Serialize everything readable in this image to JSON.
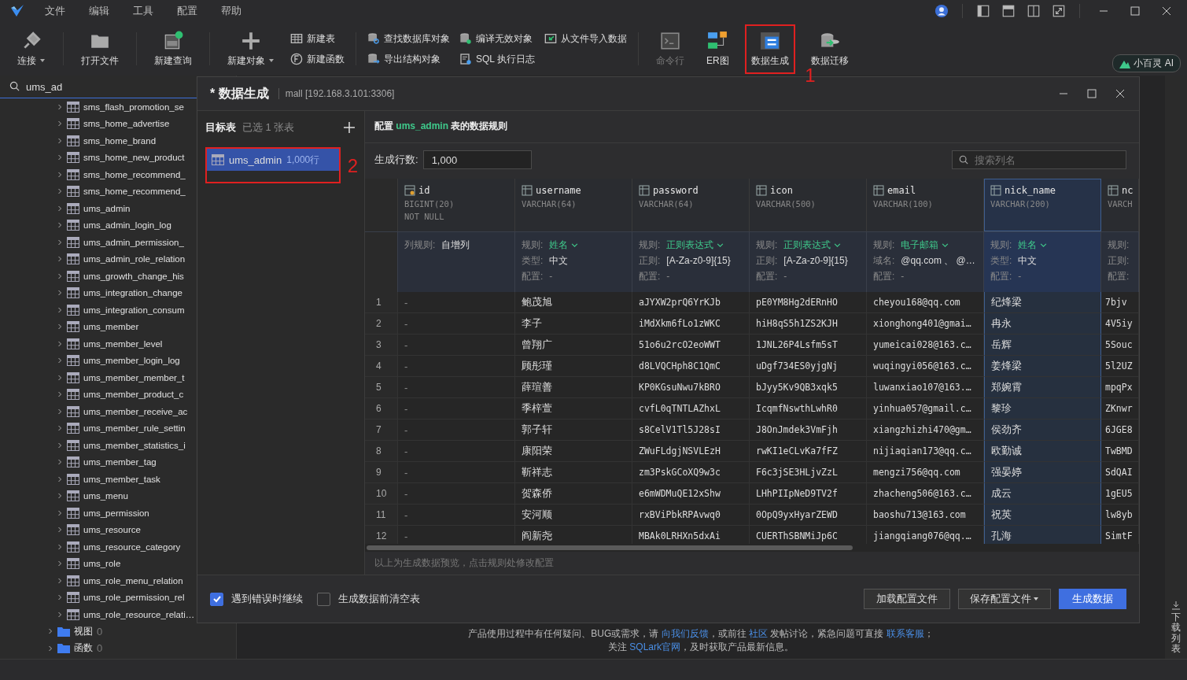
{
  "menu": [
    "文件",
    "编辑",
    "工具",
    "配置",
    "帮助"
  ],
  "toolbar": [
    {
      "items": [
        {
          "label": "连接",
          "kind": "big",
          "dropdown": true,
          "disabled": false
        }
      ]
    },
    {
      "items": [
        {
          "label": "打开文件",
          "kind": "big",
          "dropdown": false,
          "disabled": false
        }
      ]
    },
    {
      "items": [
        {
          "label": "新建查询",
          "kind": "big",
          "dropdown": false,
          "disabled": false
        }
      ]
    },
    {
      "items": [
        {
          "label": "新建对象",
          "kind": "big",
          "dropdown": true,
          "disabled": false
        },
        {
          "label": "新建表",
          "kind": "small",
          "dropdown": false,
          "disabled": false
        },
        {
          "label": "新建函数",
          "kind": "small",
          "dropdown": false,
          "disabled": false
        }
      ]
    },
    {
      "items": [
        {
          "label": "查找数据库对象",
          "kind": "small",
          "dropdown": false,
          "disabled": false
        },
        {
          "label": "导出结构对象",
          "kind": "small",
          "dropdown": false,
          "disabled": false
        },
        {
          "label": "编译无效对象",
          "kind": "small",
          "dropdown": false,
          "disabled": false
        },
        {
          "label": "SQL 执行日志",
          "kind": "small",
          "dropdown": false,
          "disabled": false
        },
        {
          "label": "从文件导入数据",
          "kind": "small",
          "dropdown": false,
          "disabled": false
        }
      ]
    },
    {
      "items": [
        {
          "label": "命令行",
          "kind": "big",
          "dropdown": false,
          "disabled": true
        },
        {
          "label": "ER图",
          "kind": "big",
          "dropdown": false,
          "disabled": false
        },
        {
          "label": "数据生成",
          "kind": "big",
          "dropdown": false,
          "disabled": false,
          "annotation": "1"
        },
        {
          "label": "数据迁移",
          "kind": "big",
          "dropdown": false,
          "disabled": false
        }
      ]
    }
  ],
  "ai_button": "小百灵 AI",
  "sidebar": {
    "search": "ums_ad",
    "tables": [
      "sms_flash_promotion_se",
      "sms_home_advertise",
      "sms_home_brand",
      "sms_home_new_product",
      "sms_home_recommend_",
      "sms_home_recommend_",
      "ums_admin",
      "ums_admin_login_log",
      "ums_admin_permission_",
      "ums_admin_role_relation",
      "ums_growth_change_his",
      "ums_integration_change",
      "ums_integration_consum",
      "ums_member",
      "ums_member_level",
      "ums_member_login_log",
      "ums_member_member_t",
      "ums_member_product_c",
      "ums_member_receive_ac",
      "ums_member_rule_settin",
      "ums_member_statistics_i",
      "ums_member_tag",
      "ums_member_task",
      "ums_menu",
      "ums_permission",
      "ums_resource",
      "ums_resource_category",
      "ums_role",
      "ums_role_menu_relation",
      "ums_role_permission_rel",
      "ums_role_resource_relati…"
    ],
    "folders": [
      {
        "label": "视图",
        "count": "0"
      },
      {
        "label": "函数",
        "count": "0"
      }
    ]
  },
  "help": [
    [
      {
        "text": "产品使用过程中有任何疑问、BUG或需求，请 ",
        "link": false
      },
      {
        "text": "向我们反馈",
        "link": true
      },
      {
        "text": "，或前往 ",
        "link": false
      },
      {
        "text": "社区",
        "link": true
      },
      {
        "text": " 发帖讨论，紧急问题可直接 ",
        "link": false
      },
      {
        "text": "联系客服",
        "link": true
      },
      {
        "text": "；",
        "link": false
      }
    ],
    [
      {
        "text": "关注 ",
        "link": false
      },
      {
        "text": "SQLark官网",
        "link": true
      },
      {
        "text": "，及时获取产品最新信息。",
        "link": false
      }
    ]
  ],
  "download_list": "下载列表",
  "dialog": {
    "title": "* 数据生成",
    "connection": "mall [192.168.3.101:3306]",
    "targets_title": "目标表",
    "targets_count": "已选 1 张表",
    "targets": [
      {
        "name": "ums_admin",
        "rows": "1,000行",
        "selected": true,
        "annotation": "2"
      }
    ],
    "config_prefix": "配置",
    "config_table": "ums_admin",
    "config_suffix": "表的数据规则",
    "row_count_label": "生成行数:",
    "row_count": "1,000",
    "search": {
      "placeholder": "搜索列名"
    },
    "columns": [
      {
        "kind": "key",
        "name": "id",
        "type": "BIGINT(20)",
        "constraint": "NOT NULL",
        "rule_label": "列规则:",
        "rule": "自增列",
        "selected": false
      },
      {
        "kind": "plain",
        "name": "username",
        "type": "VARCHAR(64)",
        "rule_label": "规则:",
        "rule": "姓名",
        "detail_label": "类型:",
        "detail": "中文",
        "config_label": "配置:",
        "config": "-",
        "selected": false
      },
      {
        "kind": "plain",
        "name": "password",
        "type": "VARCHAR(64)",
        "rule_label": "规则:",
        "rule": "正则表达式",
        "detail_label": "正则:",
        "detail": "[A-Za-z0-9]{15}",
        "config_label": "配置:",
        "config": "-",
        "selected": false
      },
      {
        "kind": "plain",
        "name": "icon",
        "type": "VARCHAR(500)",
        "rule_label": "规则:",
        "rule": "正则表达式",
        "detail_label": "正则:",
        "detail": "[A-Za-z0-9]{15}",
        "config_label": "配置:",
        "config": "-",
        "selected": false
      },
      {
        "kind": "plain",
        "name": "email",
        "type": "VARCHAR(100)",
        "rule_label": "规则:",
        "rule": "电子邮箱",
        "detail_label": "域名:",
        "detail": "@qq.com 、 @…",
        "config_label": "配置:",
        "config": "-",
        "selected": false
      },
      {
        "kind": "plain",
        "name": "nick_name",
        "type": "VARCHAR(200)",
        "rule_label": "规则:",
        "rule": "姓名",
        "detail_label": "类型:",
        "detail": "中文",
        "config_label": "配置:",
        "config": "-",
        "selected": true
      },
      {
        "kind": "plain",
        "name": "nc",
        "type": "VARCH",
        "rule_label": "规则:",
        "detail_label": "正则:",
        "config_label": "配置:",
        "selected": false
      }
    ],
    "rows": [
      {
        "number": "1",
        "cells": [
          "-",
          "鲍茂旭",
          "aJYXW2prQ6YrKJb",
          "pE0YM8Hg2dERnHO",
          "cheyou168@qq.com",
          "纪烽梁",
          "7bjv"
        ]
      },
      {
        "number": "2",
        "cells": [
          "-",
          "李子",
          "iMdXkm6fLo1zWKC",
          "hiH8qS5h1ZS2KJH",
          "xionghong401@gmai…",
          "冉永",
          "4V5iy"
        ]
      },
      {
        "number": "3",
        "cells": [
          "-",
          "曾翔广",
          "51o6u2rcO2eoWWT",
          "1JNL26P4Lsfm5sT",
          "yumeicai028@163.c…",
          "岳辉",
          "5Souc"
        ]
      },
      {
        "number": "4",
        "cells": [
          "-",
          "顾彤瑾",
          "d8LVQCHph8C1QmC",
          "uDgf734ES0yjgNj",
          "wuqingyi056@163.c…",
          "姜烽梁",
          "5l2UZ"
        ]
      },
      {
        "number": "5",
        "cells": [
          "-",
          "薛瑄善",
          "KP0KGsuNwu7kBRO",
          "bJyy5Kv9QB3xqk5",
          "luwanxiao107@163.…",
          "郑婉霄",
          "mpqPx"
        ]
      },
      {
        "number": "6",
        "cells": [
          "-",
          "季梓萱",
          "cvfL0qTNTLAZhxL",
          "IcqmfNswthLwhR0",
          "yinhua057@gmail.c…",
          "黎珍",
          "ZKnwr"
        ]
      },
      {
        "number": "7",
        "cells": [
          "-",
          "郭子轩",
          "s8CelV1Tl5J28sI",
          "J8OnJmdek3VmFjh",
          "xiangzhizhi470@gm…",
          "侯劲齐",
          "6JGE8"
        ]
      },
      {
        "number": "8",
        "cells": [
          "-",
          "康阳荣",
          "ZWuFLdgjNSVLEzH",
          "rwKI1eCLvKa7fFZ",
          "nijiaqian173@qq.c…",
          "欧勤诚",
          "TwBMD"
        ]
      },
      {
        "number": "9",
        "cells": [
          "-",
          "靳祥志",
          "zm3PskGCoXQ9w3c",
          "F6c3jSE3HLjvZzL",
          "mengzi756@qq.com",
          "强晏婷",
          "SdQAI"
        ]
      },
      {
        "number": "10",
        "cells": [
          "-",
          "贺森侨",
          "e6mWDMuQE12xShw",
          "LHhPIIpNeD9TV2f",
          "zhacheng506@163.c…",
          "成云",
          "1gEU5"
        ]
      },
      {
        "number": "11",
        "cells": [
          "-",
          "安河顺",
          "rxBViPbkRPAvwq0",
          "0OpQ9yxHyarZEWD",
          "baoshu713@163.com",
          "祝英",
          "lw8yb"
        ]
      },
      {
        "number": "12",
        "cells": [
          "-",
          "阎新尧",
          "MBAk0LRHXn5dxAi",
          "CUERThSBNMiJp6C",
          "jiangqiang076@qq.…",
          "孔海",
          "SimtF"
        ]
      }
    ],
    "note": "以上为生成数据预览，点击规则处修改配置",
    "options": [
      {
        "label": "遇到错误时继续",
        "checked": true
      },
      {
        "label": "生成数据前清空表",
        "checked": false
      }
    ],
    "buttons": [
      {
        "label": "加载配置文件",
        "kind": "plain"
      },
      {
        "label": "保存配置文件",
        "kind": "dropdown"
      },
      {
        "label": "生成数据",
        "kind": "primary"
      }
    ]
  }
}
